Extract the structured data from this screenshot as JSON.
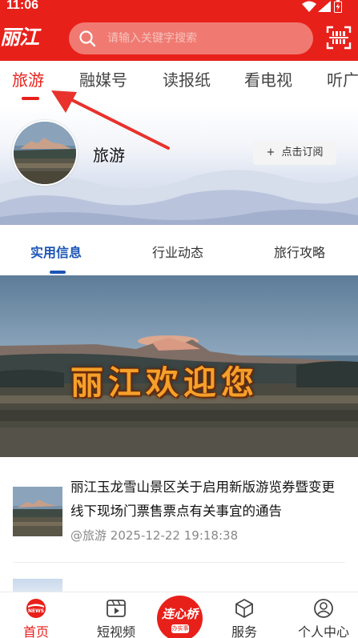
{
  "status_bar": {
    "time": "11:06"
  },
  "header": {
    "logo_text": "丽江",
    "search_placeholder": "请输入关键字搜索",
    "brand_color": "#e8201a"
  },
  "channels": [
    {
      "label": "旅游",
      "active": true
    },
    {
      "label": "融媒号",
      "active": false
    },
    {
      "label": "读报纸",
      "active": false
    },
    {
      "label": "看电视",
      "active": false
    },
    {
      "label": "听广",
      "active": false
    }
  ],
  "channel_profile": {
    "title": "旅游",
    "subscribe_label": "点击订阅",
    "subscribe_icon": "plus-icon"
  },
  "sub_tabs": [
    {
      "label": "实用信息",
      "active": true
    },
    {
      "label": "行业动态",
      "active": false
    },
    {
      "label": "旅行攻略",
      "active": false
    }
  ],
  "hero": {
    "caption": "丽江欢迎您"
  },
  "news": [
    {
      "title": "丽江玉龙雪山景区关于启用新版游览券暨变更线下现场门票售票点有关事宜的通告",
      "source": "@旅游",
      "datetime": "2025-12-22 19:18:38"
    }
  ],
  "bottom_nav": [
    {
      "label": "首页",
      "icon": "news-home-icon",
      "active": true
    },
    {
      "label": "短视频",
      "icon": "video-icon",
      "active": false
    },
    {
      "label": "连心桥",
      "sub": "办实事",
      "icon": "lianxinqiao-badge",
      "active": false
    },
    {
      "label": "服务",
      "icon": "cube-icon",
      "active": false
    },
    {
      "label": "个人中心",
      "icon": "user-icon",
      "active": false
    }
  ],
  "colors": {
    "accent_red": "#e8201a",
    "subtab_blue": "#1c55b5"
  }
}
